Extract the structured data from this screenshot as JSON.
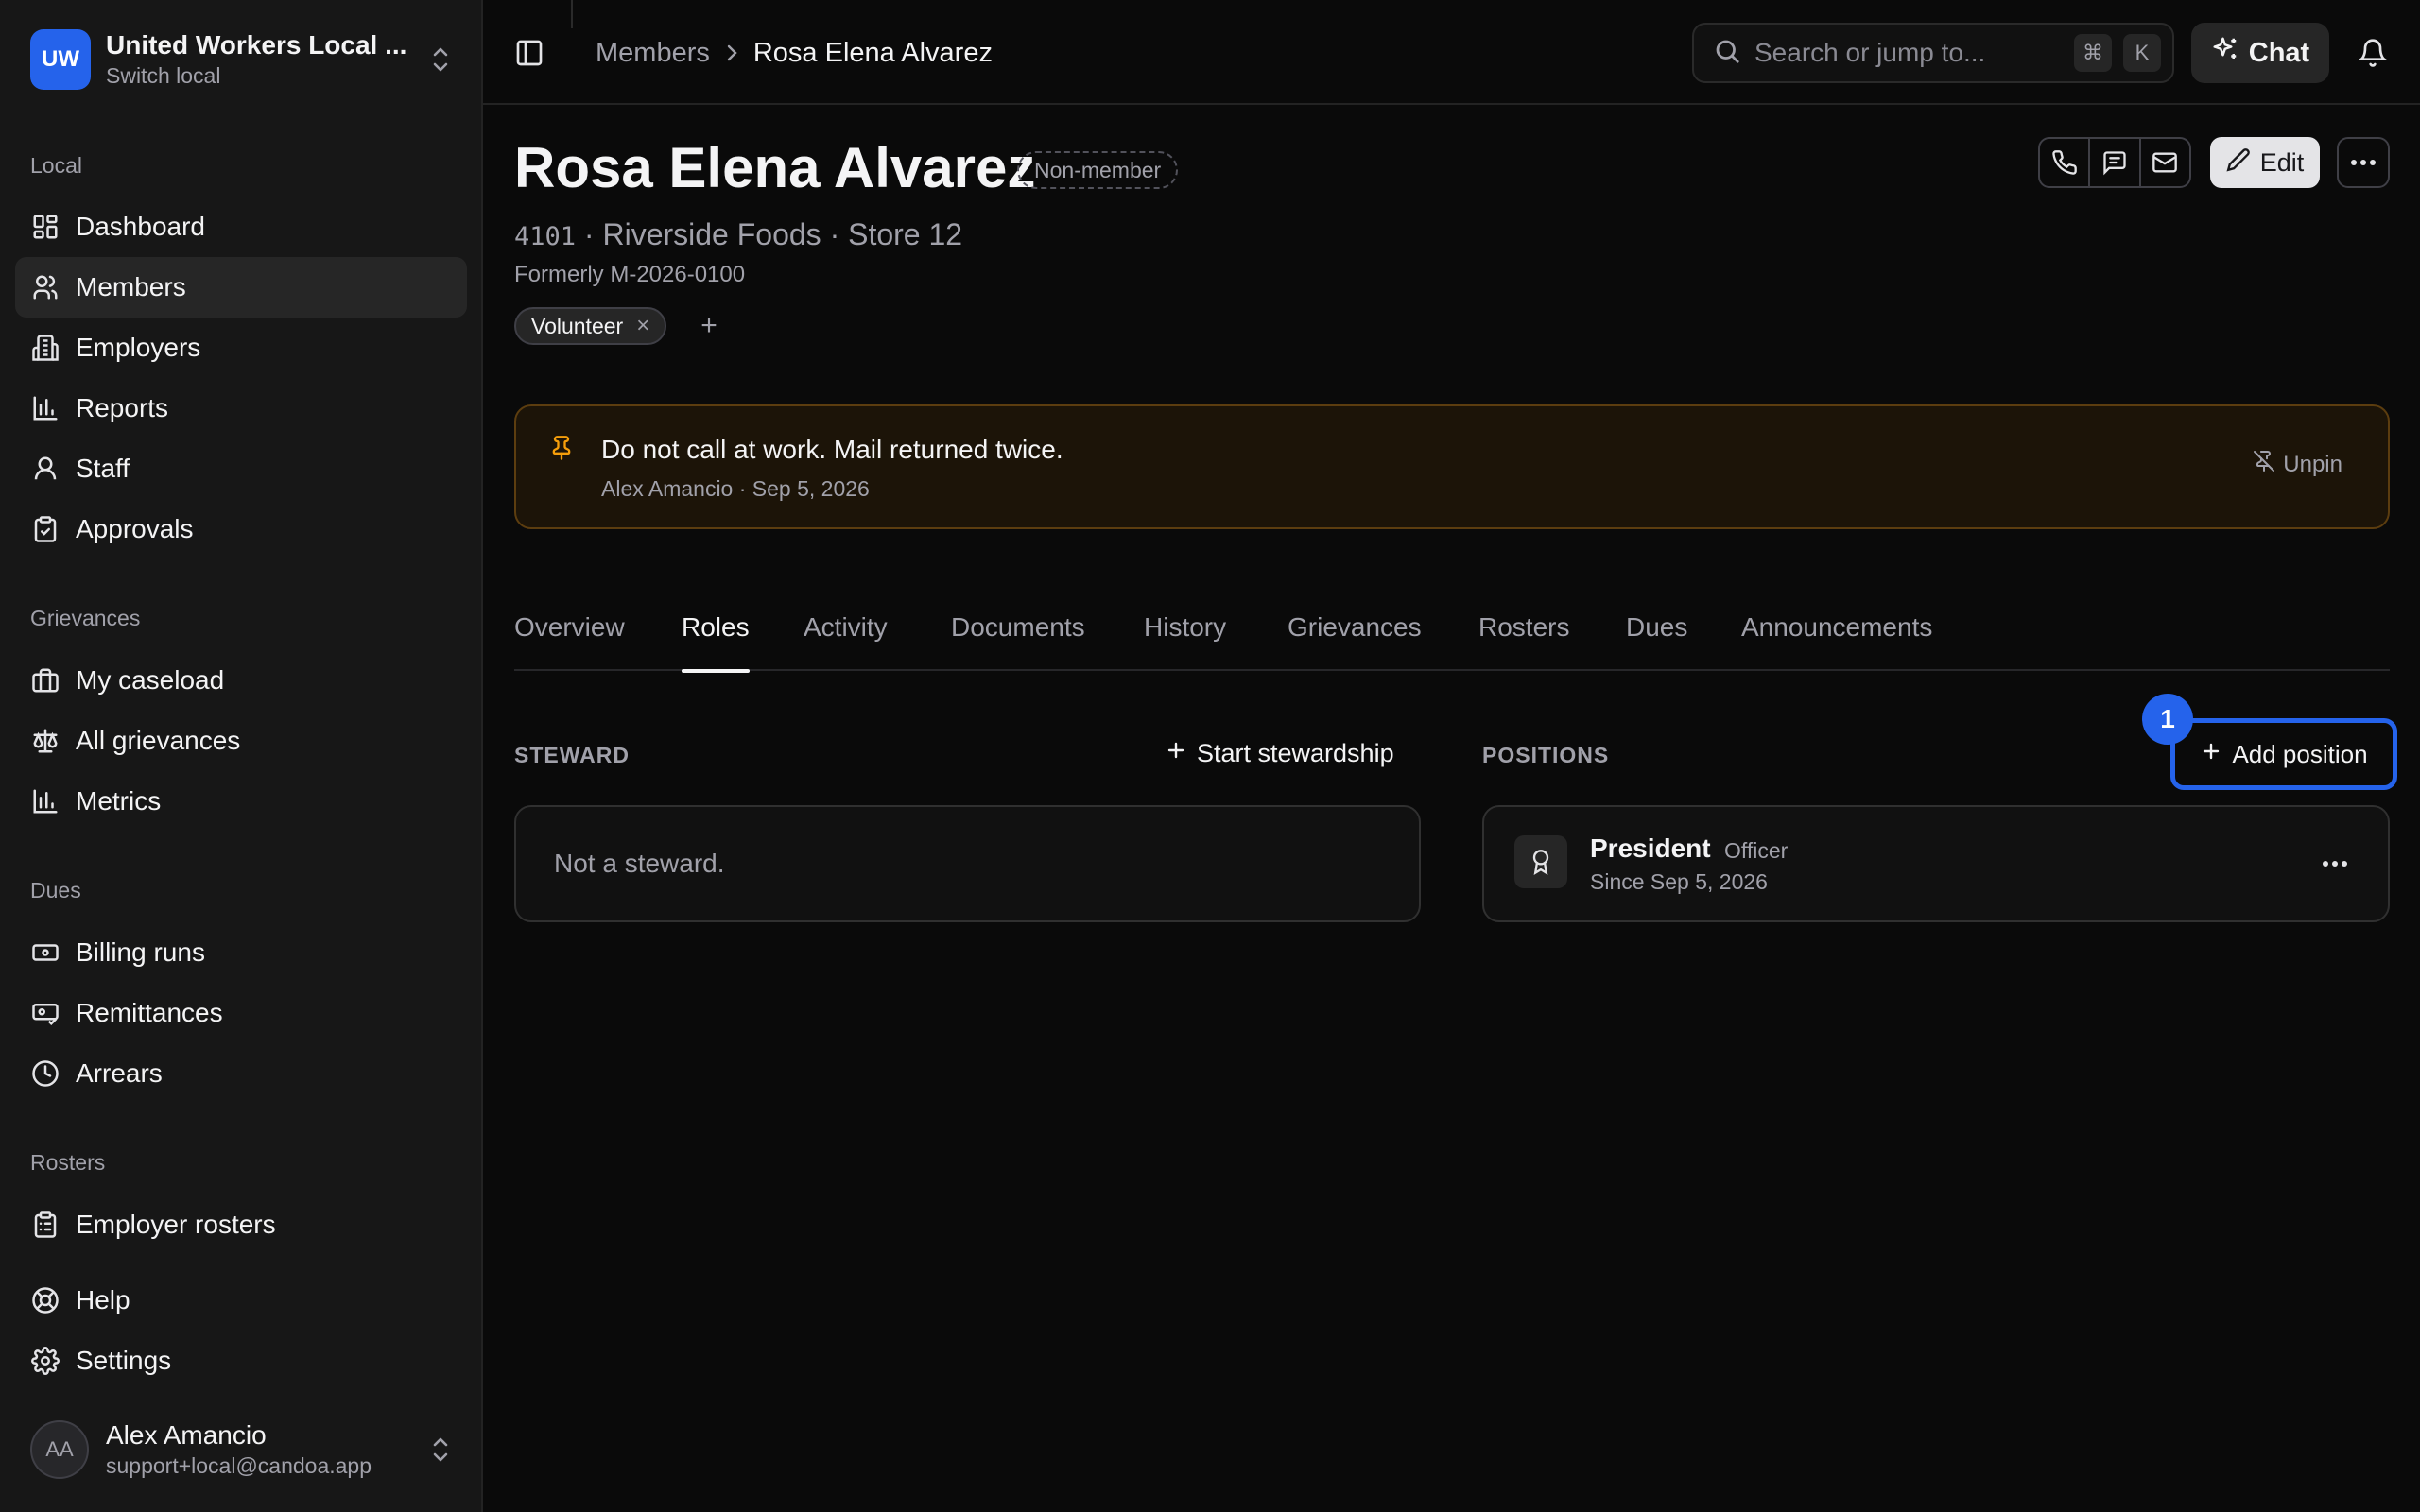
{
  "org": {
    "initials": "UW",
    "name": "United Workers Local ...",
    "sub": "Switch local"
  },
  "sidebar": {
    "sections": [
      {
        "label": "Local",
        "items": [
          {
            "label": "Dashboard",
            "icon": "dashboard-icon"
          },
          {
            "label": "Members",
            "icon": "users-icon",
            "active": true
          },
          {
            "label": "Employers",
            "icon": "building-icon"
          },
          {
            "label": "Reports",
            "icon": "bar-chart-icon"
          },
          {
            "label": "Staff",
            "icon": "user-icon"
          },
          {
            "label": "Approvals",
            "icon": "clipboard-check-icon"
          }
        ]
      },
      {
        "label": "Grievances",
        "items": [
          {
            "label": "My caseload",
            "icon": "briefcase-icon"
          },
          {
            "label": "All grievances",
            "icon": "scale-icon"
          },
          {
            "label": "Metrics",
            "icon": "bar-chart-icon"
          }
        ]
      },
      {
        "label": "Dues",
        "items": [
          {
            "label": "Billing runs",
            "icon": "banknote-icon"
          },
          {
            "label": "Remittances",
            "icon": "receipt-icon"
          },
          {
            "label": "Arrears",
            "icon": "clock-icon"
          }
        ]
      },
      {
        "label": "Rosters",
        "items": [
          {
            "label": "Employer rosters",
            "icon": "clipboard-list-icon"
          }
        ]
      }
    ],
    "footer_items": [
      {
        "label": "Help",
        "icon": "lifebuoy-icon"
      },
      {
        "label": "Settings",
        "icon": "gear-icon"
      }
    ],
    "user": {
      "initials": "AA",
      "name": "Alex Amancio",
      "email": "support+local@candoa.app"
    }
  },
  "topbar": {
    "breadcrumb": [
      "Members",
      "Rosa Elena Alvarez"
    ],
    "search_placeholder": "Search or jump to...",
    "kbd_cmd": "⌘",
    "kbd_k": "K",
    "chat_label": "Chat"
  },
  "profile": {
    "name": "Rosa Elena Alvarez",
    "status": "Non-member",
    "member_no": "4101",
    "workplace": " · Riverside Foods · Store 12",
    "formerly": "Formerly M-2026-0100",
    "tags": [
      "Volunteer"
    ],
    "edit_label": "Edit"
  },
  "note": {
    "text": "Do not call at work. Mail returned twice.",
    "by": "Alex Amancio · Sep 5, 2026",
    "unpin_label": "Unpin"
  },
  "tabs": [
    "Overview",
    "Roles",
    "Activity",
    "Documents",
    "History",
    "Grievances",
    "Rosters",
    "Dues",
    "Announcements"
  ],
  "active_tab": "Roles",
  "roles": {
    "steward_label": "STEWARD",
    "start_stewardship": "Start stewardship",
    "steward_empty": "Not a steward.",
    "positions_label": "POSITIONS",
    "add_position": "Add position",
    "step_number": "1",
    "positions": [
      {
        "title": "President",
        "kind": "Officer",
        "since": "Since Sep 5, 2026"
      }
    ]
  },
  "colors": {
    "accent": "#2563eb",
    "note_bg": "#1c1408",
    "note_border": "#5c3d0f",
    "pin": "#f59e0b"
  }
}
